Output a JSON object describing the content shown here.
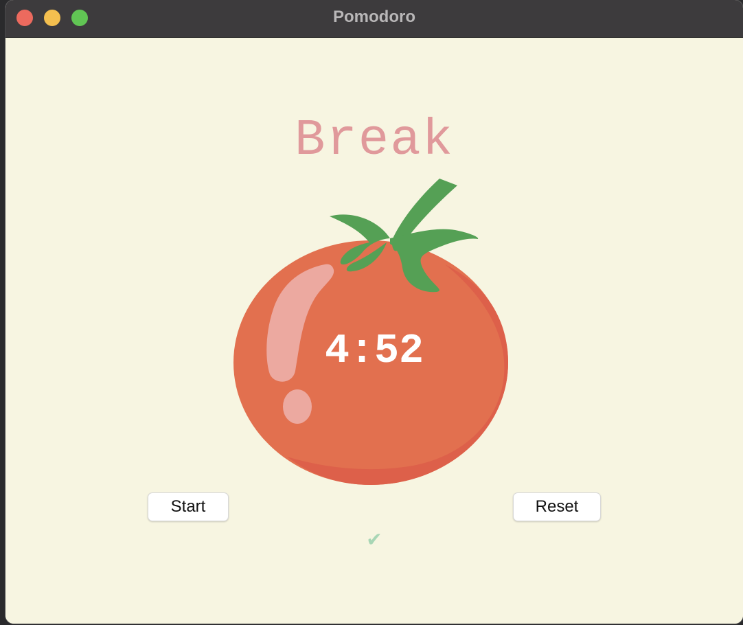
{
  "window": {
    "title": "Pomodoro"
  },
  "app": {
    "mode_label": "Break",
    "timer_text": "4:52",
    "checkmarks": "✔"
  },
  "buttons": {
    "start_label": "Start",
    "reset_label": "Reset"
  },
  "colors": {
    "background": "#f7f5e1",
    "mode_label": "#e0999b",
    "tomato_body": "#e2704f",
    "tomato_shadow": "#dd604a",
    "tomato_highlight": "#eca9a0",
    "stem": "#55a055",
    "checkmark": "#a8d6b5",
    "titlebar": "#3d3b3d"
  },
  "icons": {
    "close": "traffic-light-close",
    "minimize": "traffic-light-minimize",
    "zoom": "traffic-light-zoom",
    "tomato": "tomato-image",
    "check": "checkmark-icon"
  }
}
